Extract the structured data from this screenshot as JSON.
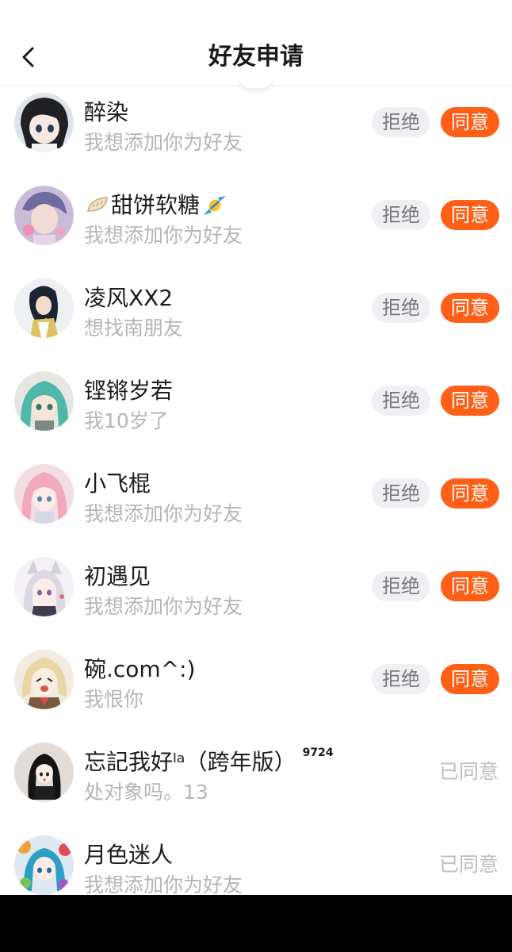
{
  "header": {
    "title": "好友申请",
    "back_icon": "chevron-left-icon"
  },
  "colors": {
    "accent": "#ff5f16",
    "reject_bg": "#eff0f4",
    "muted_text": "#b5b5b5"
  },
  "requests": [
    {
      "name": "醉染",
      "message": "我想添加你为好友",
      "status": "pending",
      "reject_label": "拒绝",
      "agree_label": "同意"
    },
    {
      "name": "甜饼软糖",
      "prefix_icon": "dumpling-emoji-icon",
      "suffix_icon": "candy-emoji-icon",
      "message": "我想添加你为好友",
      "status": "pending",
      "reject_label": "拒绝",
      "agree_label": "同意"
    },
    {
      "name": "凌风XX2",
      "message": "想找南朋友",
      "status": "pending",
      "reject_label": "拒绝",
      "agree_label": "同意"
    },
    {
      "name": "铿锵岁若",
      "message": "我10岁了",
      "status": "pending",
      "reject_label": "拒绝",
      "agree_label": "同意"
    },
    {
      "name": "小飞棍",
      "message": "我想添加你为好友",
      "status": "pending",
      "reject_label": "拒绝",
      "agree_label": "同意"
    },
    {
      "name": "初遇见",
      "message": "我想添加你为好友",
      "status": "pending",
      "reject_label": "拒绝",
      "agree_label": "同意"
    },
    {
      "name": "碗.com^:)",
      "message": "我恨你",
      "status": "pending",
      "reject_label": "拒绝",
      "agree_label": "同意"
    },
    {
      "name": "忘記我好ˡᵃ（跨年版）",
      "badge": "9724",
      "message": "处对象吗。13",
      "status": "agreed",
      "agreed_label": "已同意"
    },
    {
      "name": "月色迷人",
      "message": "我想添加你为好友",
      "status": "agreed",
      "agreed_label": "已同意"
    }
  ]
}
